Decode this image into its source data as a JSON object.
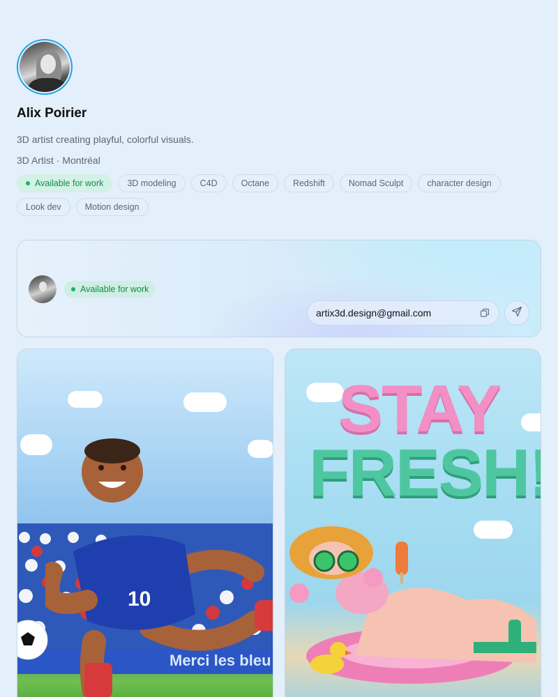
{
  "profile": {
    "name": "Alix Poirier",
    "bio": "3D artist creating playful, colorful visuals.",
    "meta": "3D Artist · Montréal",
    "tags": [
      {
        "label": "Available for work",
        "status": true
      },
      {
        "label": "3D modeling"
      },
      {
        "label": "C4D"
      },
      {
        "label": "Octane"
      },
      {
        "label": "Redshift"
      },
      {
        "label": "Nomad Sculpt"
      },
      {
        "label": "character design"
      },
      {
        "label": "Look dev"
      },
      {
        "label": "Motion design"
      }
    ]
  },
  "contact": {
    "status": "Available for work",
    "email": "artix3d.design@gmail.com",
    "copy_icon": "copy-icon",
    "send_icon": "send-icon"
  },
  "gallery": {
    "tiles": [
      {
        "banner_text": "Merci les bleu"
      },
      {
        "title_line1": "STAY",
        "title_line2": "FRESH!"
      }
    ]
  },
  "colors": {
    "accent_ring": "#1aa3e8",
    "available_green": "#138a4e",
    "available_bg": "#d3f1e6",
    "background": "#e3effb"
  }
}
